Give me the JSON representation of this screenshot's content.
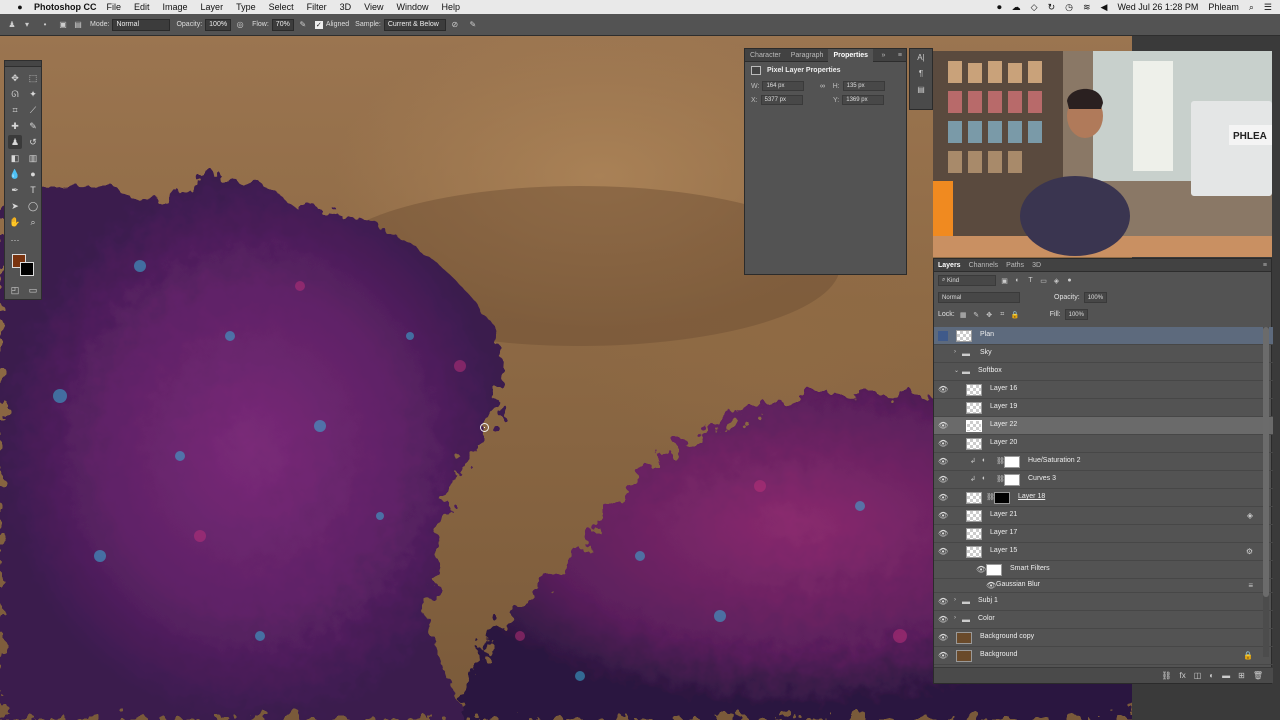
{
  "menubar": {
    "app_name": "Photoshop CC",
    "items": [
      "File",
      "Edit",
      "Image",
      "Layer",
      "Type",
      "Select",
      "Filter",
      "3D",
      "View",
      "Window",
      "Help"
    ],
    "clock": "Wed Jul 26  1:28 PM",
    "user": "Phleam"
  },
  "options": {
    "mode_label": "Mode:",
    "mode_value": "Normal",
    "opacity_label": "Opacity:",
    "opacity_value": "100%",
    "flow_label": "Flow:",
    "flow_value": "70%",
    "aligned_label": "Aligned",
    "sample_label": "Sample:",
    "sample_value": "Current & Below"
  },
  "properties": {
    "tabs": [
      "Character",
      "Paragraph",
      "Properties"
    ],
    "active_tab": "Properties",
    "title": "Pixel Layer Properties",
    "w_label": "W:",
    "w_value": "164 px",
    "h_label": "H:",
    "h_value": "135 px",
    "x_label": "X:",
    "x_value": "5377 px",
    "y_label": "Y:",
    "y_value": "1369 px"
  },
  "layers_panel": {
    "tabs": [
      "Layers",
      "Channels",
      "Paths",
      "3D"
    ],
    "active_tab": "Layers",
    "filter_label": "Kind",
    "blend_mode": "Normal",
    "opacity_label": "Opacity:",
    "opacity_value": "100%",
    "lock_label": "Lock:",
    "fill_label": "Fill:",
    "fill_value": "100%",
    "layers": [
      {
        "name": "Plan",
        "visible": false,
        "type": "pixel"
      },
      {
        "name": "Sky",
        "visible": false,
        "type": "group"
      },
      {
        "name": "Softbox",
        "visible": false,
        "type": "group-open"
      },
      {
        "name": "Layer 16",
        "visible": true,
        "type": "pixel"
      },
      {
        "name": "Layer 19",
        "visible": false,
        "type": "pixel"
      },
      {
        "name": "Layer 22",
        "visible": true,
        "type": "pixel",
        "selected": true
      },
      {
        "name": "Layer 20",
        "visible": true,
        "type": "pixel"
      },
      {
        "name": "Hue/Saturation 2",
        "visible": true,
        "type": "adjustment"
      },
      {
        "name": "Curves 3",
        "visible": true,
        "type": "adjustment"
      },
      {
        "name": "Layer 18",
        "visible": true,
        "type": "masked"
      },
      {
        "name": "Layer 21",
        "visible": true,
        "type": "pixel"
      },
      {
        "name": "Layer 17",
        "visible": true,
        "type": "pixel"
      },
      {
        "name": "Layer 15",
        "visible": true,
        "type": "smart"
      },
      {
        "name": "Smart Filters",
        "visible": true,
        "type": "smart-filters"
      },
      {
        "name": "Gaussian Blur",
        "visible": true,
        "type": "filter"
      },
      {
        "name": "Subj 1",
        "visible": true,
        "type": "group"
      },
      {
        "name": "Color",
        "visible": true,
        "type": "group"
      },
      {
        "name": "Background copy",
        "visible": true,
        "type": "image"
      },
      {
        "name": "Background",
        "visible": true,
        "type": "image-locked"
      }
    ]
  },
  "colors": {
    "foreground": "#7a3410",
    "background": "#000000"
  }
}
